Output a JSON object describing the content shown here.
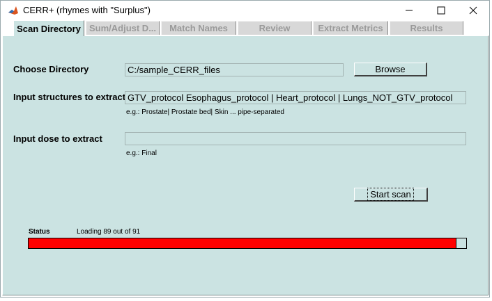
{
  "window": {
    "title": "CERR+ (rhymes with \"Surplus\")",
    "minimize_icon": "minimize-icon",
    "maximize_icon": "maximize-icon",
    "close_icon": "close-icon"
  },
  "tabs": [
    {
      "label": "Scan Directory",
      "active": true
    },
    {
      "label": "Sum/Adjust D...",
      "active": false
    },
    {
      "label": "Match Names",
      "active": false
    },
    {
      "label": "Review",
      "active": false
    },
    {
      "label": "Extract Metrics",
      "active": false
    },
    {
      "label": "Results",
      "active": false
    }
  ],
  "directory": {
    "label": "Choose Directory",
    "value": "C:/sample_CERR_files",
    "browse_label": "Browse"
  },
  "structures": {
    "label": "Input structures to extract",
    "value": "GTV_protocol Esophagus_protocol | Heart_protocol | Lungs_NOT_GTV_protocol",
    "hint": "e.g.: Prostate| Prostate bed| Skin ... pipe-separated"
  },
  "dose": {
    "label": "Input dose to extract",
    "value": "",
    "hint": "e.g.: Final"
  },
  "scan": {
    "start_label": "Start scan"
  },
  "status": {
    "label": "Status",
    "text": "Loading 89 out of 91",
    "progress_fraction": 0.978,
    "progress_color": "#ff0000"
  },
  "colors": {
    "panel_bg": "#cbe3e2",
    "tab_inactive_text": "#9a9a9a"
  }
}
